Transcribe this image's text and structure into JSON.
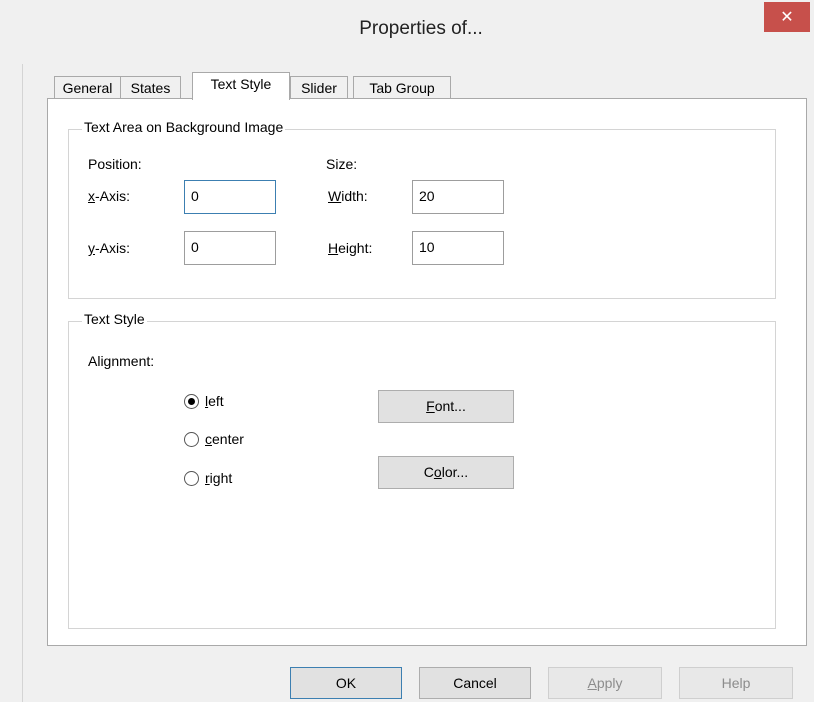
{
  "window": {
    "title": "Properties of...",
    "close_glyph": "✕"
  },
  "tabs": [
    {
      "label": "General",
      "active": false
    },
    {
      "label": "States",
      "active": false
    },
    {
      "label": "Text Style",
      "active": true
    },
    {
      "label": "Slider",
      "active": false
    },
    {
      "label": "Tab Group",
      "active": false
    }
  ],
  "text_area": {
    "legend": "Text Area on Background Image",
    "position_label": "Position:",
    "size_label": "Size:",
    "x_label_ul": "x",
    "x_label_rest": "-Axis:",
    "x_value": "0",
    "y_label_ul": "y",
    "y_label_rest": "-Axis:",
    "y_value": "0",
    "width_label_ul": "W",
    "width_label_rest": "idth:",
    "width_value": "20",
    "height_label_ul": "H",
    "height_label_rest": "eight:",
    "height_value": "10"
  },
  "text_style": {
    "legend": "Text Style",
    "alignment_label": "Alignment:",
    "options": [
      {
        "ul": "l",
        "rest": "eft",
        "checked": true
      },
      {
        "ul": "c",
        "rest": "enter",
        "checked": false
      },
      {
        "ul": "r",
        "rest": "ight",
        "checked": false
      }
    ],
    "font_button_ul": "F",
    "font_button_rest": "ont...",
    "color_button_pre": "C",
    "color_button_ul": "o",
    "color_button_rest": "lor..."
  },
  "buttons": {
    "ok": "OK",
    "cancel": "Cancel",
    "apply_ul": "A",
    "apply_rest": "pply",
    "help": "Help"
  }
}
